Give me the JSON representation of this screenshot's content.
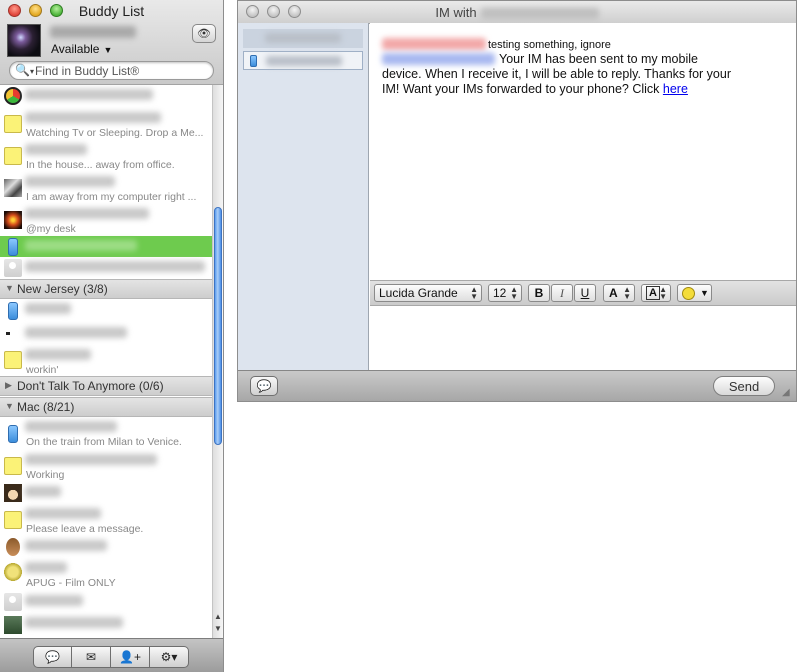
{
  "buddy_window": {
    "title": "Buddy List",
    "status": "Available",
    "search_placeholder": "Find in Buddy List®"
  },
  "buddies_top": [
    {
      "icon": "aim-icon",
      "status": ""
    },
    {
      "icon": "away-note-icon",
      "status": "Watching Tv or Sleeping. Drop a Me..."
    },
    {
      "icon": "away-note-icon",
      "status": "In the house... away from office."
    },
    {
      "icon": "buddy-photo-icon",
      "status": "I am away from my computer right ..."
    },
    {
      "icon": "buddy-photo-icon",
      "status": "@my desk"
    },
    {
      "icon": "mobile-phone-icon",
      "status": "",
      "selected": true
    },
    {
      "icon": "default-buddy-icon",
      "status": ""
    }
  ],
  "groups": [
    {
      "label": "New Jersey (3/8)"
    },
    {
      "label": "Don't Talk To Anymore (0/6)"
    },
    {
      "label": "Mac (8/21)"
    }
  ],
  "buddies_nj": [
    {
      "icon": "mobile-phone-icon",
      "status": ""
    },
    {
      "icon": "dot-icon",
      "status": ""
    },
    {
      "icon": "away-note-icon",
      "status": "workin'"
    }
  ],
  "buddies_mac": [
    {
      "icon": "mobile-phone-icon",
      "status": "On the train from Milan to Venice."
    },
    {
      "icon": "away-note-icon",
      "status": "Working"
    },
    {
      "icon": "cartoon-avatar-icon",
      "status": ""
    },
    {
      "icon": "away-note-icon",
      "status": "Please leave a message."
    },
    {
      "icon": "person-avatar-icon",
      "status": ""
    },
    {
      "icon": "emblem-avatar-icon",
      "status": "APUG - Film ONLY"
    },
    {
      "icon": "default-buddy-icon",
      "status": ""
    },
    {
      "icon": "landscape-avatar-icon",
      "status": ""
    }
  ],
  "im_window": {
    "title_prefix": "IM with",
    "message1": "testing something, ignore",
    "message2": "Your IM has been sent to my mobile device. When I receive it, I will be able to reply. Thanks for your IM! Want your IMs forwarded to your phone? Click ",
    "link_text": "here",
    "font_name": "Lucida Grande",
    "font_size": "12",
    "bold": "B",
    "italic": "I",
    "underline": "U",
    "text_color": "A",
    "bg_color": "A",
    "send_label": "Send"
  }
}
